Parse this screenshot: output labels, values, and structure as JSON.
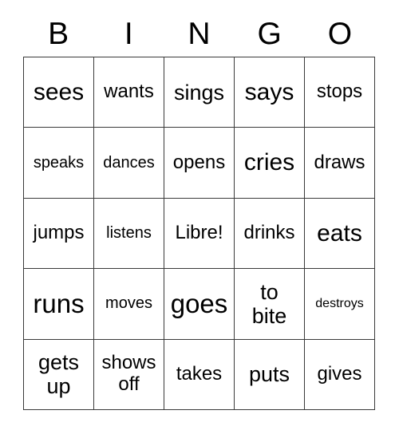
{
  "card": {
    "title": "BINGO",
    "header_letters": [
      "B",
      "I",
      "N",
      "G",
      "O"
    ],
    "grid_size": "5x5",
    "free_space": {
      "row": 3,
      "column": 3,
      "label": "Libre!"
    },
    "colors": {
      "background": "#ffffff",
      "text": "#000000",
      "grid_line": "#3a3a3a"
    },
    "rows": [
      [
        {
          "text": "sees",
          "size": "fs-xl",
          "lines": 1
        },
        {
          "text": "wants",
          "size": "fs-m",
          "lines": 1
        },
        {
          "text": "sings",
          "size": "fs-l",
          "lines": 1
        },
        {
          "text": "says",
          "size": "fs-xl",
          "lines": 1
        },
        {
          "text": "stops",
          "size": "fs-m",
          "lines": 1
        }
      ],
      [
        {
          "text": "speaks",
          "size": "fs-s",
          "lines": 1
        },
        {
          "text": "dances",
          "size": "fs-s",
          "lines": 1
        },
        {
          "text": "opens",
          "size": "fs-m",
          "lines": 1
        },
        {
          "text": "cries",
          "size": "fs-xl",
          "lines": 1
        },
        {
          "text": "draws",
          "size": "fs-m",
          "lines": 1
        }
      ],
      [
        {
          "text": "jumps",
          "size": "fs-m",
          "lines": 1
        },
        {
          "text": "listens",
          "size": "fs-s",
          "lines": 1
        },
        {
          "text": "Libre!",
          "size": "fs-m",
          "lines": 1
        },
        {
          "text": "drinks",
          "size": "fs-m",
          "lines": 1
        },
        {
          "text": "eats",
          "size": "fs-xl",
          "lines": 1
        }
      ],
      [
        {
          "text": "runs",
          "size": "fs-xxl",
          "lines": 1
        },
        {
          "text": "moves",
          "size": "fs-s",
          "lines": 1
        },
        {
          "text": "goes",
          "size": "fs-xxl",
          "lines": 1
        },
        {
          "text": "to\nbite",
          "size": "fs-l",
          "lines": 2
        },
        {
          "text": "destroys",
          "size": "fs-xs",
          "lines": 1
        }
      ],
      [
        {
          "text": "gets\nup",
          "size": "fs-l",
          "lines": 2
        },
        {
          "text": "shows\noff",
          "size": "fs-m",
          "lines": 2
        },
        {
          "text": "takes",
          "size": "fs-m",
          "lines": 1
        },
        {
          "text": "puts",
          "size": "fs-l",
          "lines": 1
        },
        {
          "text": "gives",
          "size": "fs-m",
          "lines": 1
        }
      ]
    ]
  }
}
